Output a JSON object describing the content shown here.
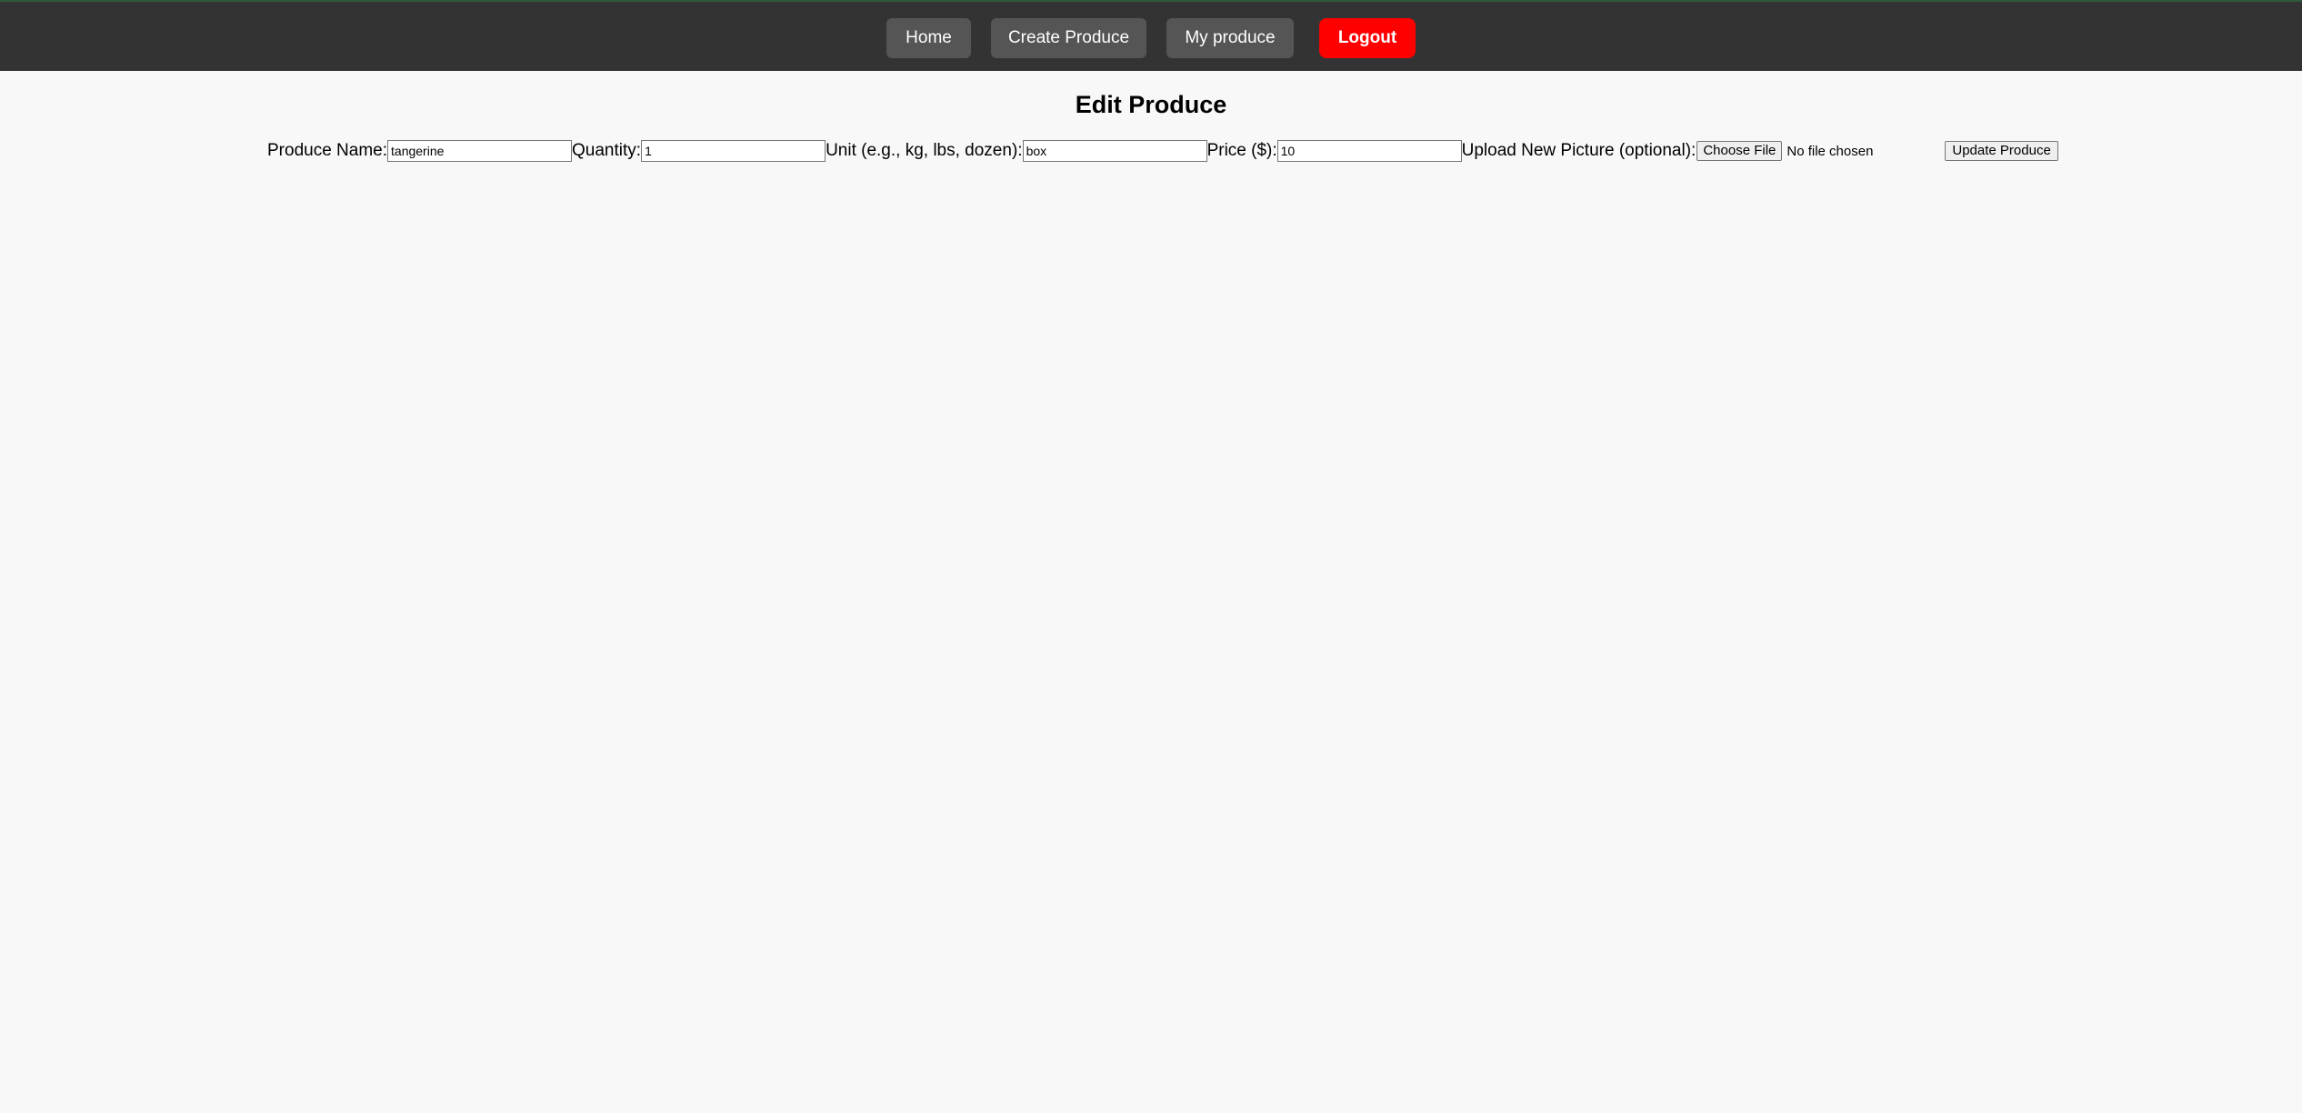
{
  "nav": {
    "home": "Home",
    "create": "Create Produce",
    "mine": "My produce",
    "logout": "Logout"
  },
  "page": {
    "title": "Edit Produce"
  },
  "form": {
    "name_label": "Produce Name:",
    "name_value": "tangerine",
    "quantity_label": "Quantity:",
    "quantity_value": "1",
    "unit_label": "Unit (e.g., kg, lbs, dozen):",
    "unit_value": "box",
    "price_label": "Price ($):",
    "price_value": "10",
    "picture_label": "Upload New Picture (optional):",
    "choose_file": "Choose File",
    "file_status": "No file chosen",
    "submit": "Update Produce"
  },
  "colors": {
    "topbar": "#333333",
    "nav_button": "#555555",
    "logout_button": "#ff0000",
    "page_background": "#f8f8f8"
  }
}
